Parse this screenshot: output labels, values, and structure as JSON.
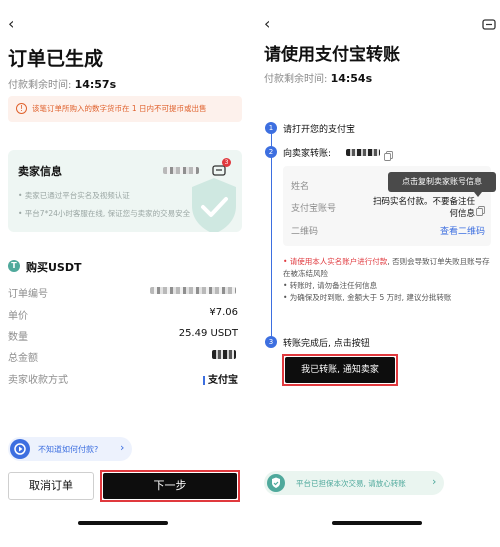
{
  "left": {
    "back_glyph": "‹",
    "title": "订单已生成",
    "timer_label": "付款剩余时间:",
    "timer_value": "14:57s",
    "warning_text": "该笔订单所购入的数字货币在 1 日内不可提币或出售",
    "seller": {
      "title": "卖家信息",
      "badge_count": "3",
      "note_1": "• 卖家已通过平台实名及视频认证",
      "note_2": "• 平台7*24小时客服在线, 保证您与卖家的交易安全"
    },
    "buy_title": "购买USDT",
    "rows": [
      {
        "label": "订单编号",
        "value": ""
      },
      {
        "label": "单价",
        "value": "¥7.06"
      },
      {
        "label": "数量",
        "value": "25.49 USDT"
      },
      {
        "label": "总金额",
        "value": ""
      },
      {
        "label": "卖家收款方式",
        "value": "支付宝"
      }
    ],
    "help_text": "不知道如何付款?",
    "help_arrow": "›",
    "cancel_label": "取消订单",
    "next_label": "下一步"
  },
  "right": {
    "back_glyph": "‹",
    "title": "请使用支付宝转账",
    "timer_label": "付款剩余时间:",
    "timer_value": "14:54s",
    "step_1": "请打开您的支付宝",
    "step_2_label": "向卖家转账:",
    "step_3": "转账完成后, 点击按钮",
    "step_numbers": [
      "1",
      "2",
      "3"
    ],
    "fields": {
      "name_label": "姓名",
      "account_label": "支付宝账号",
      "account_value": "扫码实名付款。不要备注任何信息",
      "qr_label": "二维码",
      "qr_link": "查看二维码"
    },
    "tooltip": "点击复制卖家账号信息",
    "notes": {
      "n1_red": "• 请使用本人实名账户进行付款",
      "n1_rest": ", 否则会导致订单失败且账号存在被冻结风险",
      "n2": "• 转账时, 请勿备注任何信息",
      "n3": "• 为确保及时到账, 金额大于 5 万时, 建议分批转账"
    },
    "notify_label": "我已转账, 通知卖家",
    "safety_text": "平台已担保本次交易, 请放心转账",
    "safety_arrow": "›"
  },
  "colors": {
    "accent_red": "#e0393e",
    "teal": "#4fa99c",
    "blue": "#3d6fe0",
    "dark": "#0d0d0d"
  }
}
